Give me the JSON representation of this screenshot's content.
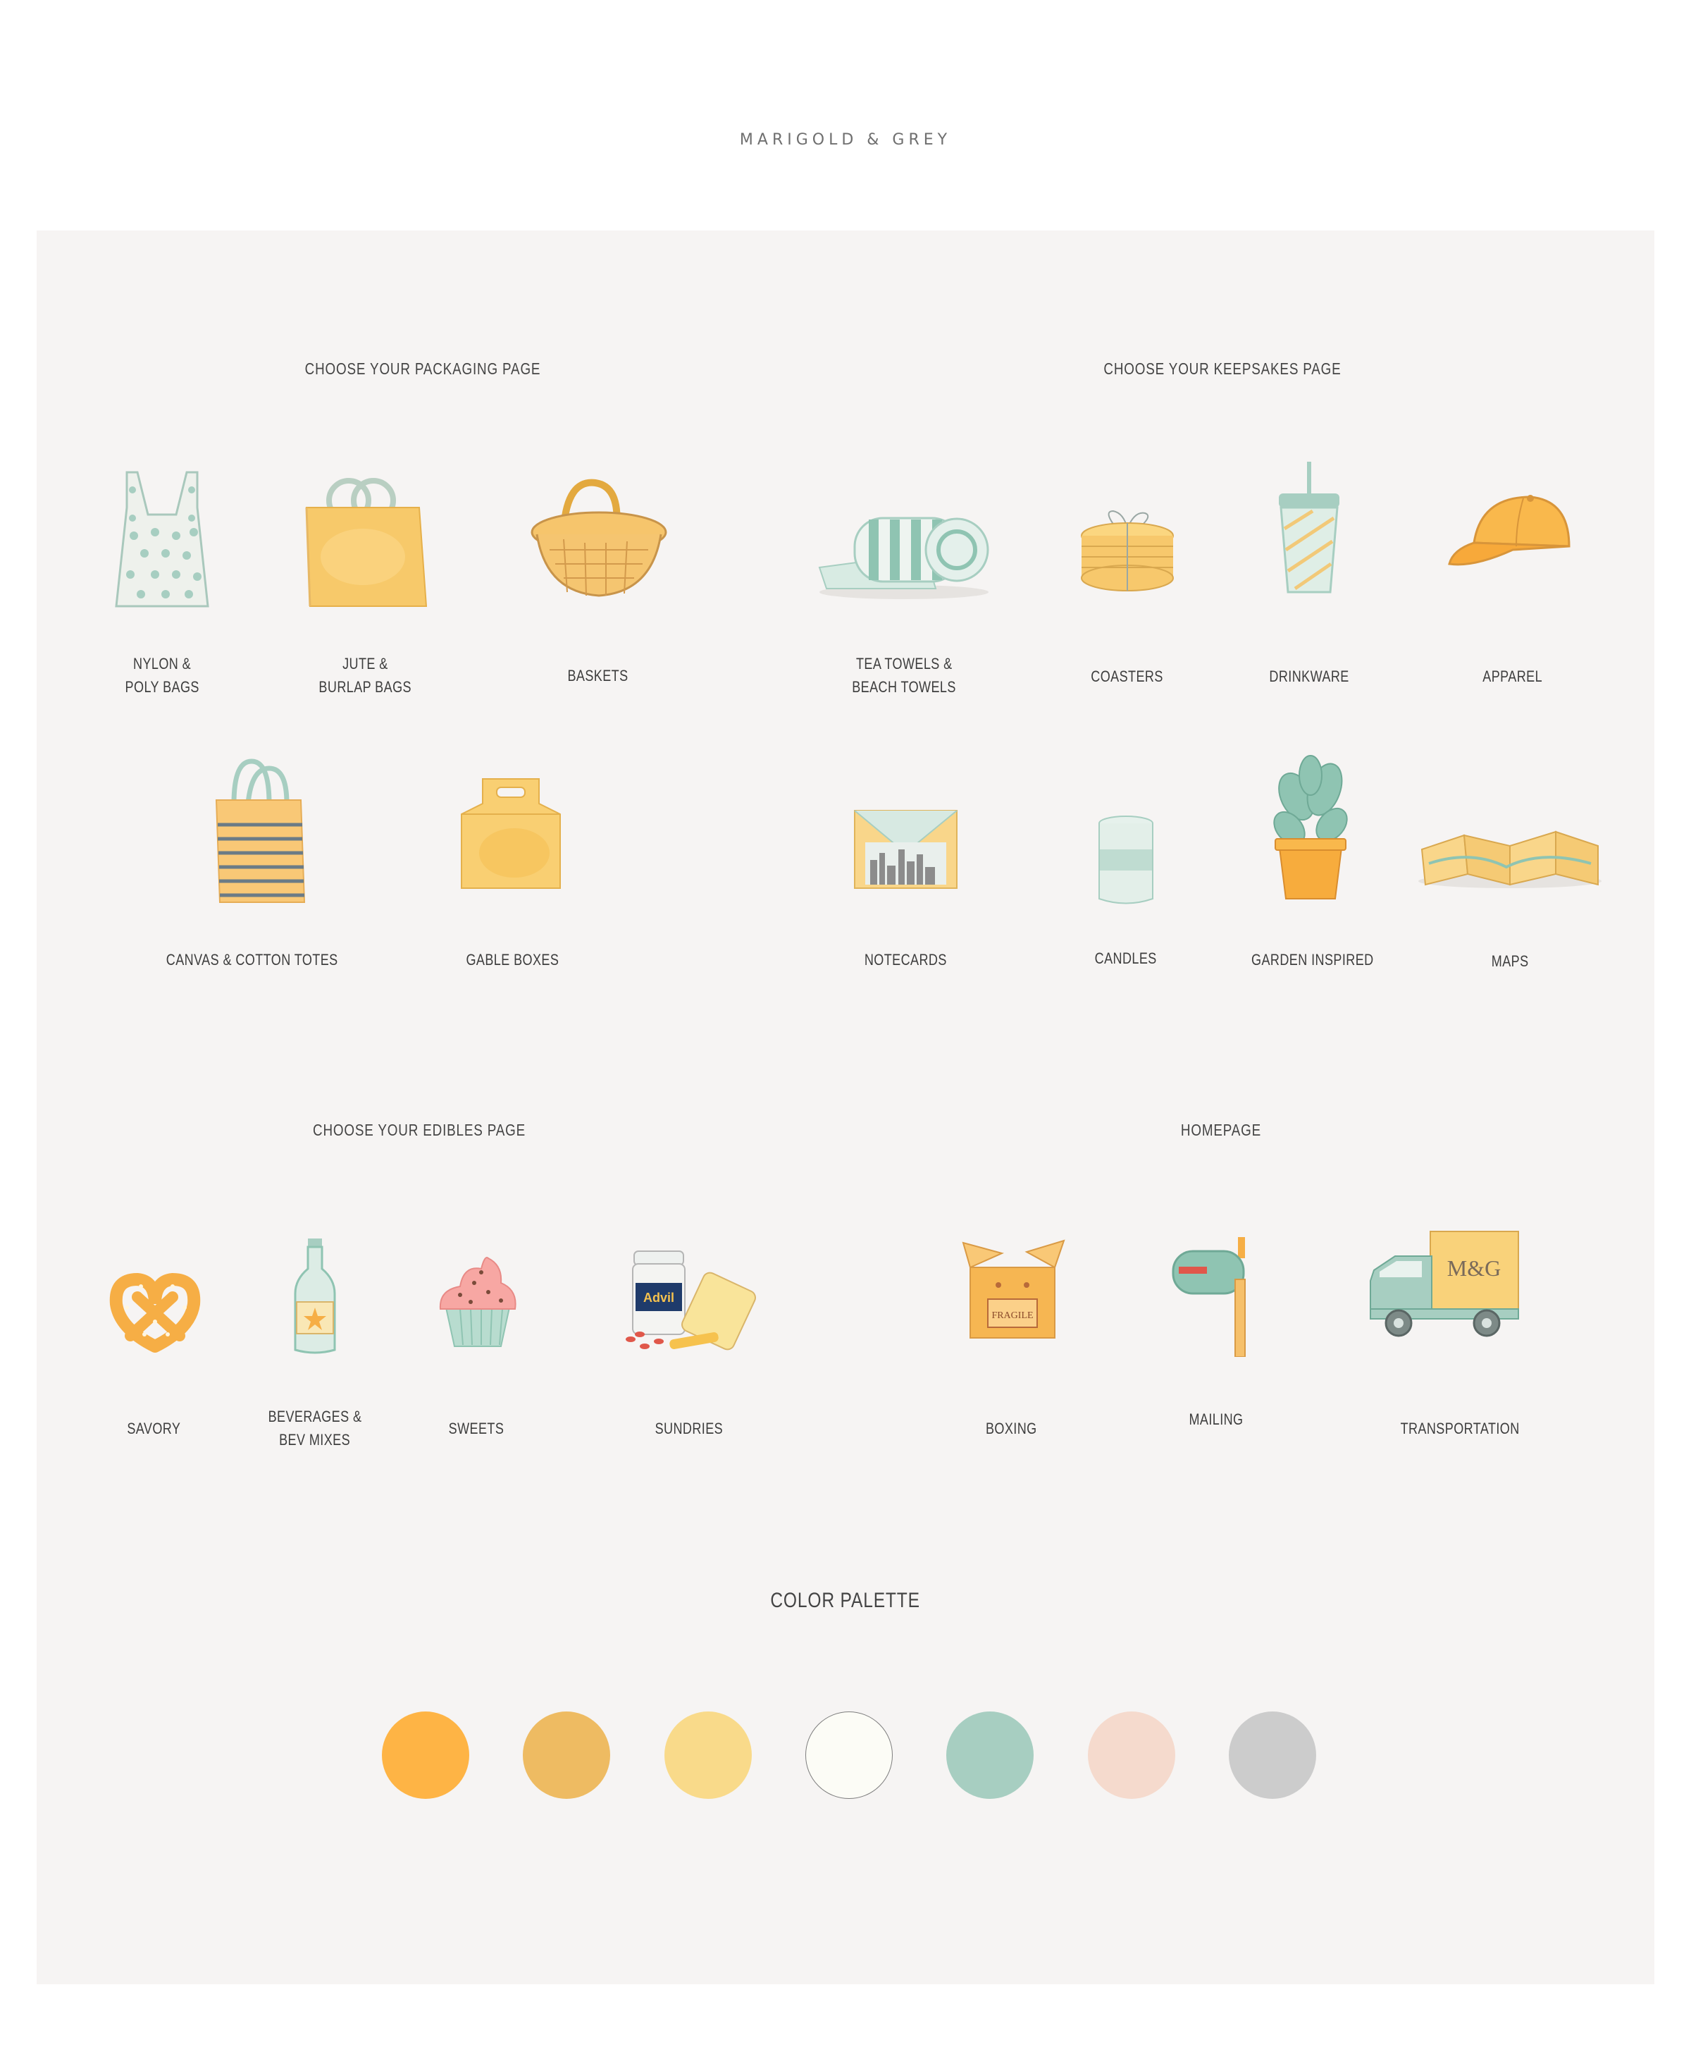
{
  "brand": "MARIGOLD & GREY",
  "sections": {
    "packaging": "CHOOSE YOUR PACKAGING PAGE",
    "keepsakes": "CHOOSE YOUR KEEPSAKES PAGE",
    "edibles": "CHOOSE YOUR EDIBLES PAGE",
    "homepage": "HOMEPAGE"
  },
  "packaging_items": [
    {
      "line1": "NYLON &",
      "line2": "POLY BAGS",
      "icon": "polka-dot-bag-icon"
    },
    {
      "line1": "JUTE &",
      "line2": "BURLAP BAGS",
      "icon": "jute-bag-icon"
    },
    {
      "line1": "BASKETS",
      "line2": "",
      "icon": "basket-icon"
    },
    {
      "line1": "CANVAS & COTTON TOTES",
      "line2": "",
      "icon": "striped-tote-icon"
    },
    {
      "line1": "GABLE BOXES",
      "line2": "",
      "icon": "gable-box-icon"
    }
  ],
  "keepsake_items": [
    {
      "line1": "TEA TOWELS &",
      "line2": "BEACH TOWELS",
      "icon": "rolled-towel-icon"
    },
    {
      "line1": "COASTERS",
      "line2": "",
      "icon": "coasters-icon"
    },
    {
      "line1": "DRINKWARE",
      "line2": "",
      "icon": "tumbler-icon"
    },
    {
      "line1": "APPAREL",
      "line2": "",
      "icon": "cap-icon"
    },
    {
      "line1": "NOTECARDS",
      "line2": "",
      "icon": "notecard-icon"
    },
    {
      "line1": "CANDLES",
      "line2": "",
      "icon": "candle-icon"
    },
    {
      "line1": "GARDEN INSPIRED",
      "line2": "",
      "icon": "potted-plant-icon"
    },
    {
      "line1": "MAPS",
      "line2": "",
      "icon": "folded-map-icon"
    }
  ],
  "edible_items": [
    {
      "line1": "SAVORY",
      "line2": "",
      "icon": "pretzel-icon"
    },
    {
      "line1": "BEVERAGES &",
      "line2": "BEV MIXES",
      "icon": "bottle-icon"
    },
    {
      "line1": "SWEETS",
      "line2": "",
      "icon": "cupcake-icon"
    },
    {
      "line1": "SUNDRIES",
      "line2": "",
      "icon": "sundries-icon"
    }
  ],
  "home_items": [
    {
      "line1": "BOXING",
      "line2": "",
      "icon": "fragile-box-icon"
    },
    {
      "line1": "MAILING",
      "line2": "",
      "icon": "mailbox-icon"
    },
    {
      "line1": "TRANSPORTATION",
      "line2": "",
      "icon": "delivery-truck-icon"
    }
  ],
  "box_text": "FRAGILE",
  "truck_logo": "M&G",
  "sundries_brand": "Advil",
  "palette": {
    "title": "COLOR PALETTE",
    "colors": [
      "#FEB445",
      "#EEBB62",
      "#F9DA8A",
      "#FCFCF6",
      "#A7CEC1",
      "#F5DACD",
      "#CCCCCC"
    ]
  }
}
